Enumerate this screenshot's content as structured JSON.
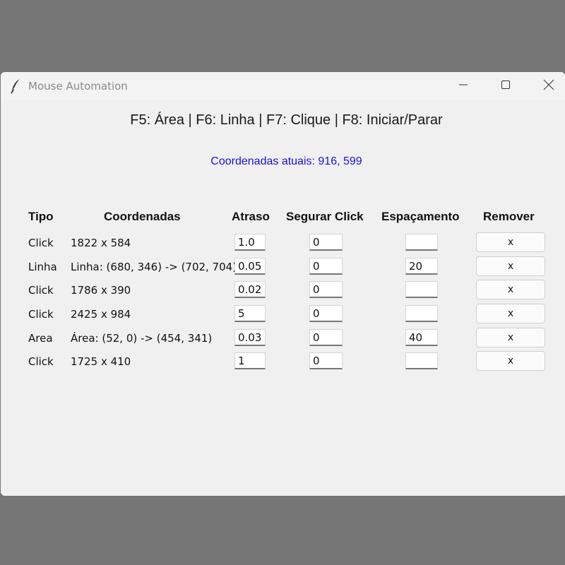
{
  "window": {
    "title": "Mouse Automation",
    "app_icon": "feather-icon",
    "controls": {
      "minimize_icon": "minimize-icon",
      "maximize_icon": "maximize-icon",
      "close_icon": "close-icon"
    }
  },
  "hotkeys_text": "F5: Área | F6: Linha | F7: Clique | F8: Iniciar/Parar",
  "current_coords_text": "Coordenadas atuais: 916, 599",
  "colors": {
    "coords_text": "#1a12d8",
    "background": "#f0f0f0"
  },
  "table": {
    "headers": {
      "tipo": "Tipo",
      "coordenadas": "Coordenadas",
      "atraso": "Atraso",
      "segurar_click": "Segurar Click",
      "espacamento": "Espaçamento",
      "remover": "Remover"
    },
    "rows": [
      {
        "tipo": "Click",
        "coordenadas": "1822 x 584",
        "atraso": "1.0",
        "segurar": "0",
        "espacamento": "",
        "remover_label": "x"
      },
      {
        "tipo": "Linha",
        "coordenadas": "Linha: (680, 346) -> (702, 704)",
        "atraso": "0.05",
        "segurar": "0",
        "espacamento": "20",
        "remover_label": "x"
      },
      {
        "tipo": "Click",
        "coordenadas": "1786 x 390",
        "atraso": "0.02",
        "segurar": "0",
        "espacamento": "",
        "remover_label": "x"
      },
      {
        "tipo": "Click",
        "coordenadas": "2425 x 984",
        "atraso": "5",
        "segurar": "0",
        "espacamento": "",
        "remover_label": "x"
      },
      {
        "tipo": "Area",
        "coordenadas": "Área: (52, 0) -> (454, 341)",
        "atraso": "0.03",
        "segurar": "0",
        "espacamento": "40",
        "remover_label": "x"
      },
      {
        "tipo": "Click",
        "coordenadas": "1725 x 410",
        "atraso": "1",
        "segurar": "0",
        "espacamento": "",
        "remover_label": "x"
      }
    ]
  }
}
